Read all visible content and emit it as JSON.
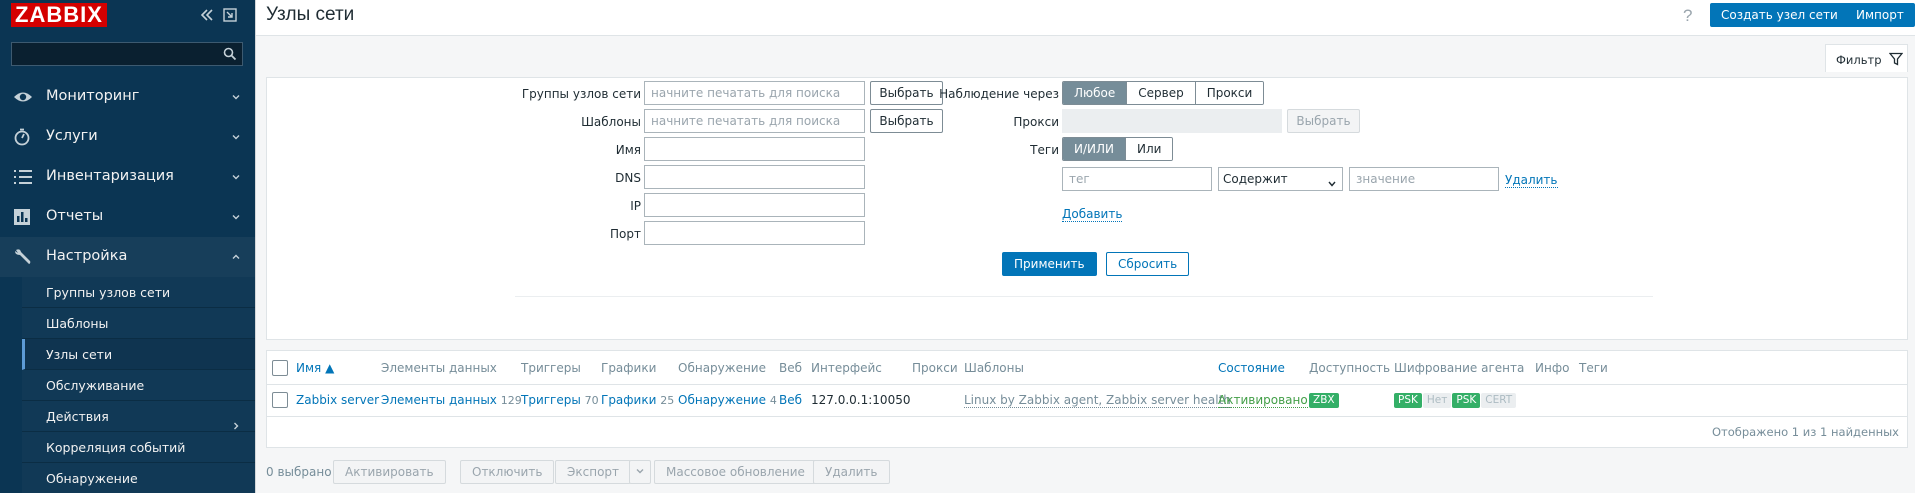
{
  "sidebar": {
    "logo": "ZABBIX",
    "search_placeholder": "",
    "menu": [
      {
        "label": "Мониторинг",
        "icon": "eye-icon"
      },
      {
        "label": "Услуги",
        "icon": "stopwatch-icon"
      },
      {
        "label": "Инвентаризация",
        "icon": "list-icon"
      },
      {
        "label": "Отчеты",
        "icon": "bar-chart-icon"
      },
      {
        "label": "Настройка",
        "icon": "wrench-icon"
      }
    ],
    "submenu": [
      {
        "label": "Группы узлов сети"
      },
      {
        "label": "Шаблоны"
      },
      {
        "label": "Узлы сети"
      },
      {
        "label": "Обслуживание"
      },
      {
        "label": "Действия"
      },
      {
        "label": "Корреляция событий"
      },
      {
        "label": "Обнаружение"
      }
    ]
  },
  "header": {
    "title": "Узлы сети",
    "help": "?",
    "create_button": "Создать узел сети",
    "import_button": "Импорт"
  },
  "filter": {
    "tab_label": "Фильтр",
    "host_groups_label": "Группы узлов сети",
    "host_groups_placeholder": "начните печатать для поиска",
    "templates_label": "Шаблоны",
    "templates_placeholder": "начните печатать для поиска",
    "select_button": "Выбрать",
    "name_label": "Имя",
    "dns_label": "DNS",
    "ip_label": "IP",
    "port_label": "Порт",
    "monitored_by_label": "Наблюдение через",
    "monitored_by_options": [
      "Любое",
      "Сервер",
      "Прокси"
    ],
    "proxy_label": "Прокси",
    "tags_label": "Теги",
    "tags_operator_options": [
      "И/ИЛИ",
      "Или"
    ],
    "tag_placeholder": "тег",
    "tag_operator_selected": "Содержит",
    "value_placeholder": "значение",
    "remove_link": "Удалить",
    "add_link": "Добавить",
    "apply_button": "Применить",
    "reset_button": "Сбросить"
  },
  "table": {
    "columns": [
      "Имя ▲",
      "Элементы данных",
      "Триггеры",
      "Графики",
      "Обнаружение",
      "Веб",
      "Интерфейс",
      "Прокси",
      "Шаблоны",
      "Состояние",
      "Доступность",
      "Шифрование агента",
      "Инфо",
      "Теги"
    ],
    "rows": [
      {
        "name": "Zabbix server",
        "items_label": "Элементы данных",
        "items_count": "129",
        "triggers_label": "Триггеры",
        "triggers_count": "70",
        "graphs_label": "Графики",
        "graphs_count": "25",
        "discovery_label": "Обнаружение",
        "discovery_count": "4",
        "web": "Веб",
        "interface": "127.0.0.1:10050",
        "proxy": "",
        "templates": "Linux by Zabbix agent, Zabbix server health",
        "status": "Активировано",
        "availability": "ZBX",
        "encryption": [
          "PSK",
          "Нет",
          "PSK",
          "CERT"
        ]
      }
    ],
    "footer": "Отображено 1 из 1 найденных"
  },
  "mass_actions": {
    "selected": "0 выбрано",
    "enable": "Активировать",
    "disable": "Отключить",
    "export": "Экспорт",
    "mass_update": "Массовое обновление",
    "delete": "Удалить"
  }
}
